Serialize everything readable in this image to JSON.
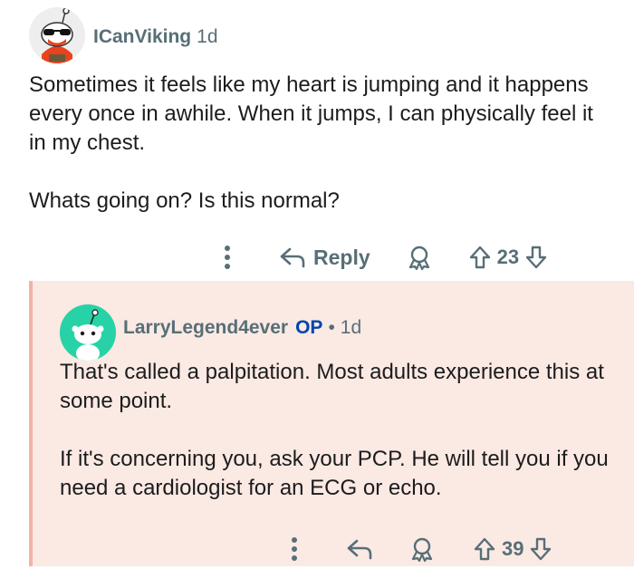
{
  "comments": [
    {
      "username": "ICanViking",
      "age": "1d",
      "paragraphs": [
        "Sometimes it feels like my heart is jumping and it happens every once in awhile. When it jumps, I can physically feel it in my chest.",
        "Whats going on? Is this normal?"
      ],
      "reply_label": "Reply",
      "score": "23",
      "avatar_icon": "snoo-sunglasses-avatar"
    },
    {
      "username": "LarryLegend4ever",
      "op_badge": "OP",
      "separator": "•",
      "age": "1d",
      "paragraphs": [
        "That's called a palpitation. Most adults experience this at some point.",
        "If it's concerning you, ask your PCP. He will tell you if you need a cardiologist for an ECG or echo."
      ],
      "score": "39",
      "avatar_icon": "snoo-default-avatar"
    }
  ],
  "colors": {
    "meta_gray": "#576f76",
    "op_blue": "#0045ac",
    "highlight_bg": "#fbe9e4",
    "thread_line": "#f2b3a4",
    "avatar_teal": "#27d3a6"
  }
}
